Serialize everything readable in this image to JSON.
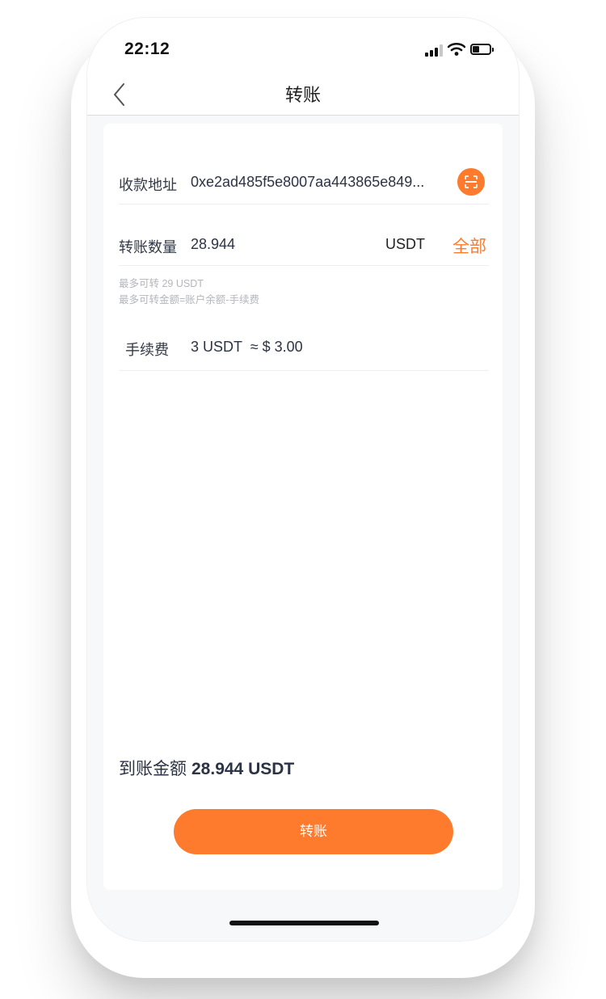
{
  "status_bar": {
    "time": "22:12",
    "icons": [
      "signal-icon",
      "wifi-icon",
      "battery-icon"
    ]
  },
  "nav": {
    "back_icon": "chevron-left-icon",
    "title": "转账"
  },
  "form": {
    "address": {
      "label": "收款地址",
      "value": "0xe2ad485f5e8007aa443865e849...",
      "scan_icon": "scan-icon"
    },
    "amount": {
      "label": "转账数量",
      "value": "28.944",
      "unit": "USDT",
      "all_label": "全部"
    },
    "hints": {
      "max": "最多可转 29 USDT",
      "formula": "最多可转金额=账户余额-手续费"
    },
    "fee": {
      "label": "手续费",
      "value": "3 USDT  ≈ $ 3.00"
    }
  },
  "summary": {
    "label": "到账金额",
    "value": "28.944 USDT"
  },
  "submit_label": "转账",
  "colors": {
    "accent": "#fe7a2c",
    "text": "#2c3344",
    "hint": "#b3b6bd",
    "background": "#f7f8fa"
  }
}
